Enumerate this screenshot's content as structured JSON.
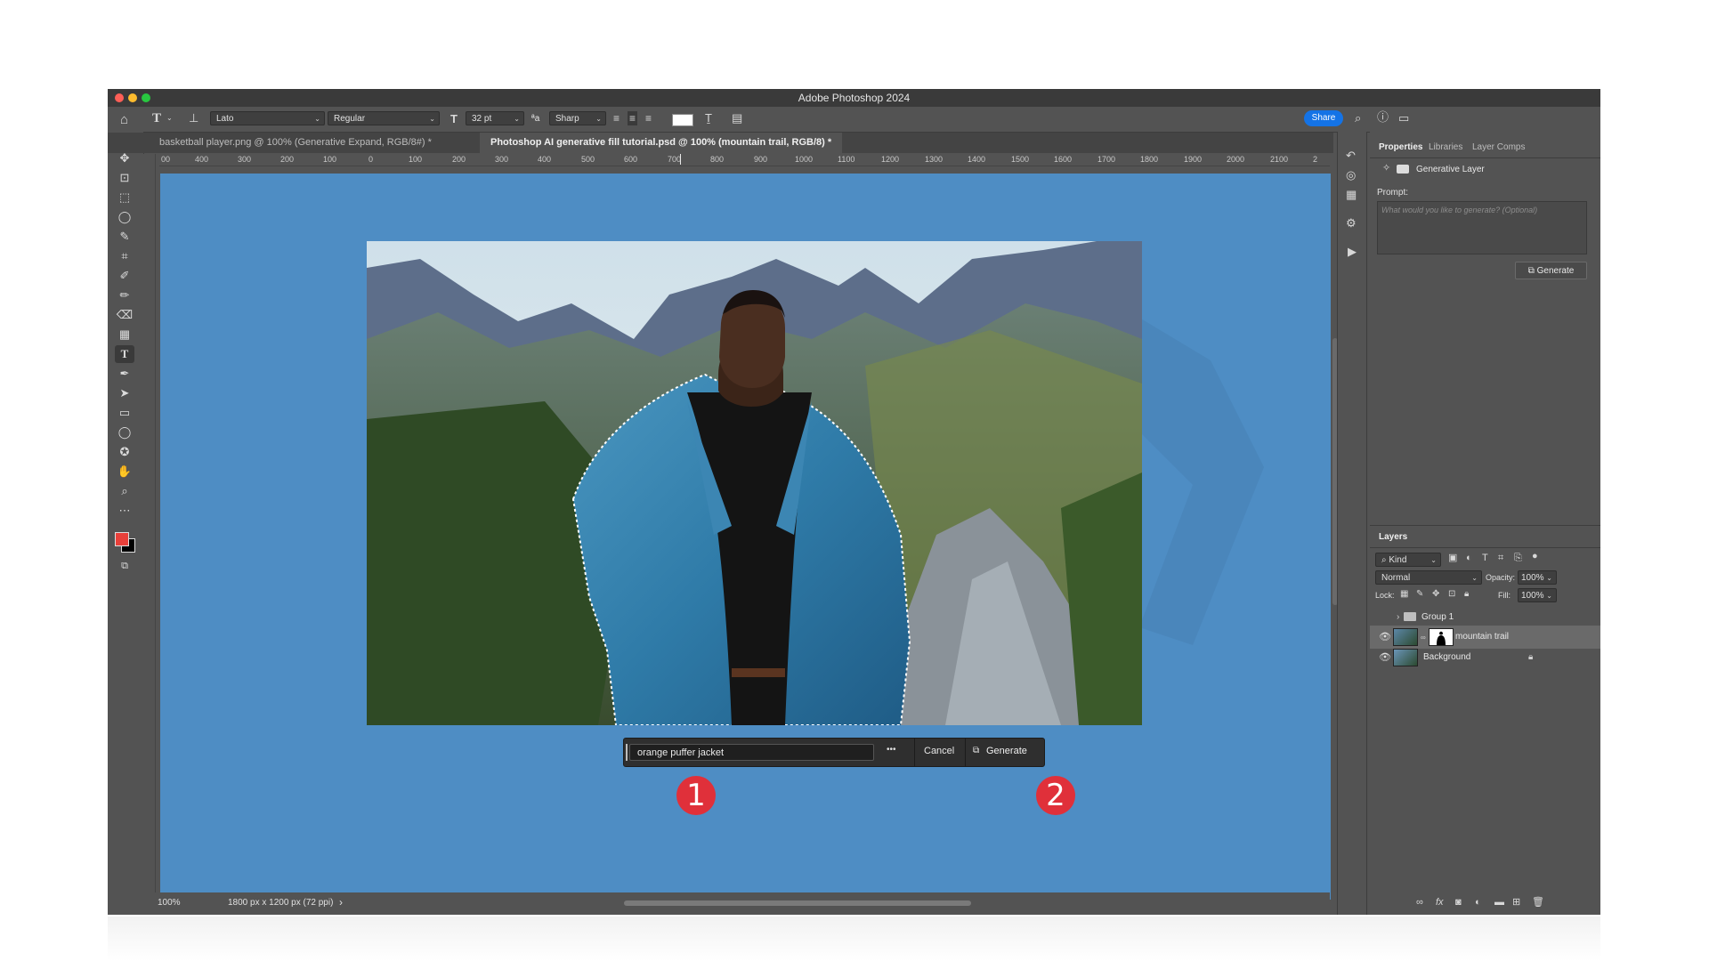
{
  "app": {
    "title": "Adobe Photoshop 2024"
  },
  "options_bar": {
    "font_family": "Lato",
    "font_style": "Regular",
    "font_size": "32 pt",
    "aa_label": "ªa",
    "antialias": "Sharp",
    "share_label": "Share"
  },
  "tabs": [
    {
      "label": "basketball player.png @ 100% (Generative Expand, RGB/8#) *"
    },
    {
      "label": "Photoshop AI generative fill tutorial.psd @ 100% (mountain trail, RGB/8) *"
    }
  ],
  "ruler": {
    "ticks": [
      "00",
      "400",
      "300",
      "200",
      "100",
      "0",
      "100",
      "200",
      "300",
      "400",
      "500",
      "600",
      "700",
      "800",
      "900",
      "1000",
      "1100",
      "1200",
      "1300",
      "1400",
      "1500",
      "1600",
      "1700",
      "1800",
      "1900",
      "2000",
      "2100",
      "2"
    ]
  },
  "context_bar": {
    "prompt_value": "orange puffer jacket",
    "more_label": "•••",
    "cancel_label": "Cancel",
    "generate_label": "Generate"
  },
  "badges": [
    "1",
    "2"
  ],
  "status": {
    "zoom": "100%",
    "doc_info": "1800 px x 1200 px (72 ppi)",
    "arrow": "›"
  },
  "properties_panel": {
    "tabs": [
      "Properties",
      "Libraries",
      "Layer Comps"
    ],
    "layer_type": "Generative Layer",
    "prompt_label": "Prompt:",
    "prompt_placeholder": "What would you like to generate? (Optional)",
    "generate_label": "Generate"
  },
  "layers_panel": {
    "title": "Layers",
    "filter_kind": "Kind",
    "blend_mode": "Normal",
    "opacity_label": "Opacity:",
    "opacity_value": "100%",
    "lock_label": "Lock:",
    "fill_label": "Fill:",
    "fill_value": "100%",
    "layers": [
      {
        "name": "Group 1"
      },
      {
        "name": "mountain trail"
      },
      {
        "name": "Background"
      }
    ]
  },
  "colors": {
    "canvas_bg": "#4e8dc4",
    "foreground": "#e8403a",
    "background_swatch": "#000000",
    "accent": "#1473e6",
    "badge": "#e0303a"
  }
}
